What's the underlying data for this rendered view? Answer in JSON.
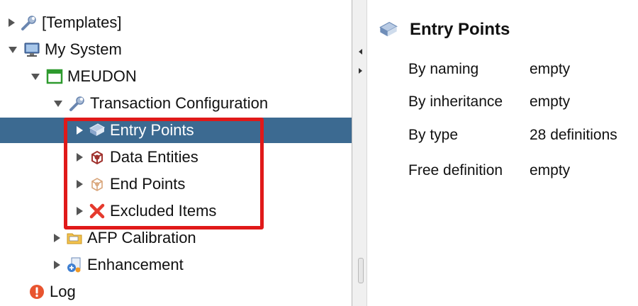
{
  "tree": {
    "items": [
      {
        "label": "[Templates]",
        "icon": "wrench-icon",
        "expanded": false,
        "level": 0
      },
      {
        "label": "My System",
        "icon": "computer-icon",
        "expanded": true,
        "level": 0
      },
      {
        "label": "MEUDON",
        "icon": "application-icon",
        "expanded": true,
        "level": 1
      },
      {
        "label": "Transaction Configuration",
        "icon": "wrench-icon",
        "expanded": true,
        "level": 2
      },
      {
        "label": "Entry Points",
        "icon": "book-icon",
        "expanded": false,
        "level": 3,
        "selected": true
      },
      {
        "label": "Data Entities",
        "icon": "cube-icon",
        "expanded": false,
        "level": 3
      },
      {
        "label": "End Points",
        "icon": "cube-outline-icon",
        "expanded": false,
        "level": 3
      },
      {
        "label": "Excluded Items",
        "icon": "red-x-icon",
        "expanded": false,
        "level": 3
      },
      {
        "label": "AFP Calibration",
        "icon": "folder-icon",
        "expanded": false,
        "level": 2
      },
      {
        "label": "Enhancement",
        "icon": "enhancement-icon",
        "expanded": false,
        "level": 2
      },
      {
        "label": "Log",
        "icon": "error-icon",
        "level": 0
      }
    ]
  },
  "detail": {
    "title": "Entry Points",
    "title_icon": "book-icon",
    "properties": [
      {
        "name": "By naming",
        "value": "empty"
      },
      {
        "name": "By inheritance",
        "value": "empty"
      },
      {
        "name": "By type",
        "value": "28 definitions"
      },
      {
        "name": "Free definition",
        "value": "empty"
      }
    ]
  },
  "colors": {
    "selection": "#3c6a91",
    "highlight_box": "#e01919"
  }
}
